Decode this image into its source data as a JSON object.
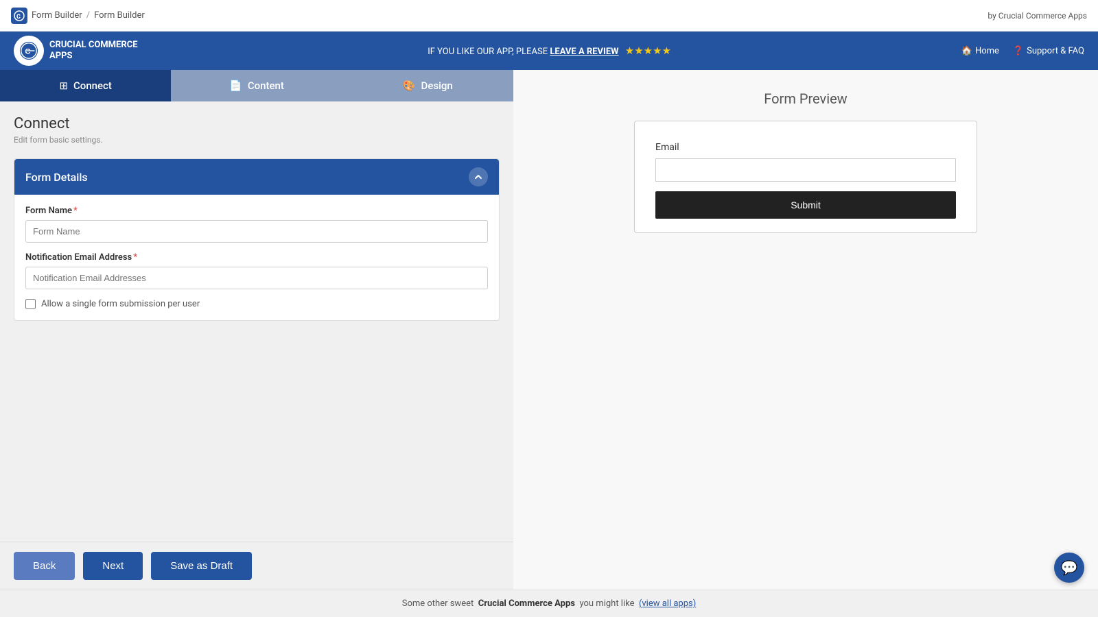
{
  "topbar": {
    "logo_label": "CC",
    "breadcrumb1": "Form Builder",
    "breadcrumb2": "Form Builder",
    "by_label": "by Crucial Commerce Apps"
  },
  "navbar": {
    "logo_line1": "CRUCIAL COMMERCE",
    "logo_line2": "APPS",
    "promo_text": "IF YOU LIKE OUR APP, PLEASE",
    "promo_link": "LEAVE A REVIEW",
    "stars": "★★★★★",
    "nav_home": "Home",
    "nav_support": "Support & FAQ"
  },
  "tabs": [
    {
      "id": "connect",
      "label": "Connect",
      "icon": "layers-icon",
      "state": "active"
    },
    {
      "id": "content",
      "label": "Content",
      "icon": "file-icon",
      "state": "inactive"
    },
    {
      "id": "design",
      "label": "Design",
      "icon": "brush-icon",
      "state": "inactive"
    }
  ],
  "section": {
    "title": "Connect",
    "subtitle": "Edit form basic settings."
  },
  "form_details": {
    "header": "Form Details",
    "form_name_label": "Form Name",
    "form_name_required": "*",
    "form_name_placeholder": "Form Name",
    "notification_email_label": "Notification Email Address",
    "notification_email_required": "*",
    "notification_email_placeholder": "Notification Email Addresses",
    "checkbox_label": "Allow a single form submission per user"
  },
  "buttons": {
    "back": "Back",
    "next": "Next",
    "save_draft": "Save as Draft"
  },
  "preview": {
    "title": "Form Preview",
    "email_label": "Email",
    "email_placeholder": "",
    "submit_label": "Submit"
  },
  "footer": {
    "text_prefix": "Some other sweet",
    "brand": "Crucial Commerce Apps",
    "text_suffix": "you might like",
    "link_label": "(view all apps)",
    "link_url": "#"
  }
}
